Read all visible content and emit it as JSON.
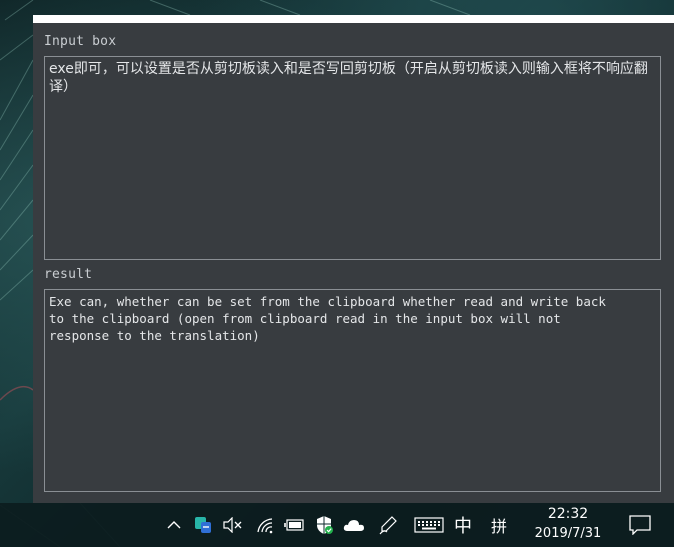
{
  "window": {
    "input_label": "Input box",
    "input_text": "exe即可，可以设置是否从剪切板读入和是否写回剪切板（开启从剪切板读入则输入框将不响应翻译）",
    "result_label": "result",
    "result_text": "Exe can, whether can be set from the clipboard whether read and write back\nto the clipboard (open from clipboard read in the input box will not\nresponse to the translation)"
  },
  "taskbar": {
    "ime_mode": "中",
    "ime_layout": "拼",
    "time": "22:32",
    "date": "2019/7/31",
    "tray_icons": [
      "chevron-up-icon",
      "app-tray-icon",
      "speaker-muted-icon",
      "wifi-icon",
      "battery-icon",
      "security-shield-icon",
      "cloud-icon",
      "pen-icon",
      "keyboard-icon",
      "notification-icon"
    ]
  }
}
